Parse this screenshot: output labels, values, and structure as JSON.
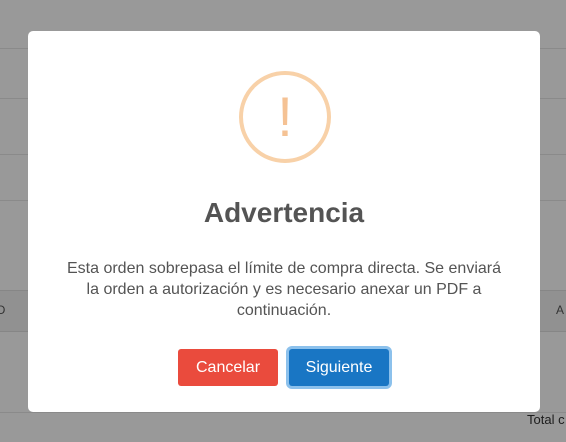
{
  "background": {
    "header_left_text": "O",
    "header_right_text": "A",
    "total_label": "Total c"
  },
  "modal": {
    "icon": "exclamation-icon",
    "icon_glyph": "!",
    "title": "Advertencia",
    "message": "Esta orden sobrepasa el límite de compra directa. Se enviará la orden a autorización y es necesario anexar un PDF a continuación.",
    "cancel_label": "Cancelar",
    "next_label": "Siguiente"
  },
  "colors": {
    "cancel": "#ea4b3d",
    "next": "#1976c4",
    "warning_ring": "#f8d1a8",
    "warning_glyph": "#f5c294"
  }
}
